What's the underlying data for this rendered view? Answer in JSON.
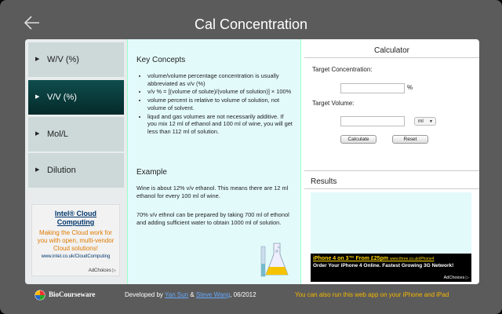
{
  "app": {
    "title": "Cal Concentration"
  },
  "sidebar": {
    "items": [
      {
        "label": "W/V (%)",
        "active": false
      },
      {
        "label": "V/V (%)",
        "active": true
      },
      {
        "label": "Mol/L",
        "active": false
      },
      {
        "label": "Dilution",
        "active": false
      }
    ],
    "ad": {
      "title": "Intel® Cloud Computing",
      "body": "Making the Cloud work for you with open, multi-vendor Cloud solutions!",
      "url": "www.intel.co.uk/CloudComputing",
      "choices": "AdChoices ▷"
    }
  },
  "content": {
    "key_concepts_heading": "Key Concepts",
    "bullets": [
      "volume/volume percentage concentration is usually abbreviated as v/v (%)",
      "v/v % = [(volume of solute)/(volume of solution)] × 100%",
      "volume percent is relative to volume of solution, not volume of solvent.",
      "liqud and gas volumes are not necessarily additive. If you mix 12 ml of ethanol and 100 ml of wine, you will get less than 112 ml of solution."
    ],
    "example_heading": "Example",
    "example_p1": "Wine is about 12% v/v ethanol. This means there are 12 ml ethanol for every 100 ml of wine.",
    "example_p2": "70% v/v ethnol can be prepared by taking 700 ml of ethonol and adding sufficient water to obtain 1000 ml of solution."
  },
  "calculator": {
    "title": "Calculator",
    "target_conc_label": "Target Concentration:",
    "target_conc_value": "",
    "percent_unit": "%",
    "target_vol_label": "Target Volume:",
    "target_vol_value": "",
    "volume_unit": "ml",
    "calculate_label": "Calculate",
    "reset_label": "Reset"
  },
  "results": {
    "title": "Results",
    "ad": {
      "headline": "iPhone 4 on 3™ From £25pm",
      "url": "www.three.co.uk/iPhone4",
      "body": "Order Your iPhone 4 Online. Fastest Growing 3G Network!",
      "choices": "AdChoices ▷"
    }
  },
  "footer": {
    "brand": "BioCourseware",
    "dev_prefix": "Developed by",
    "author1": "Yan Sun",
    "amp": "&",
    "author2": "Steve Wang",
    "date": ", 06/2012",
    "promo": "You can also run this web app on your iPhone and iPad"
  },
  "colors": {
    "accent_active": "#0f4d4d",
    "content_bg": "#e3fafb",
    "footer_promo": "#f6b800",
    "link": "#66aaff"
  },
  "icons": {
    "back": "back-arrow-icon",
    "logo": "biocourseware-logo-icon",
    "flask": "flask-illustration-icon"
  }
}
